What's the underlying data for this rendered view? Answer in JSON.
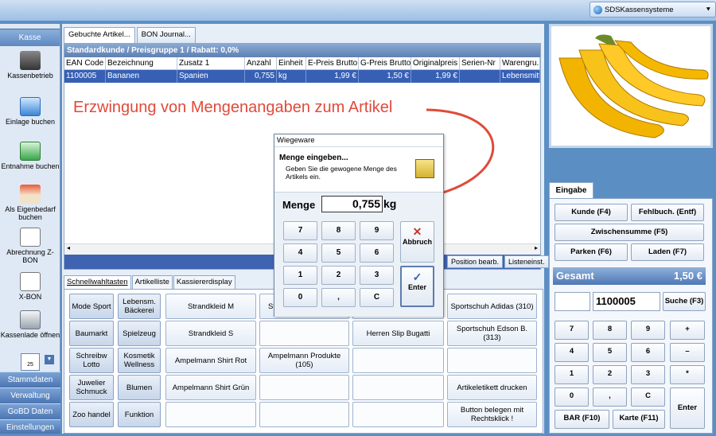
{
  "topbar": {
    "combo_label": "SDSKassensysteme"
  },
  "sidebar": {
    "header": "Kasse",
    "items": [
      "Kassenbetrieb",
      "Einlage buchen",
      "Entnahme buchen",
      "Als Eigenbedarf buchen",
      "Abrechnung Z-BON",
      "X-BON",
      "Kassenlade öffnen"
    ],
    "calendar_day": "25",
    "bottom": [
      "Stammdaten",
      "Verwaltung",
      "GoBD Daten",
      "Einstellungen"
    ]
  },
  "tabs": [
    "Gebuchte Artikel...",
    "BON Journal..."
  ],
  "grid": {
    "title": "Standardkunde / Preisgruppe 1 / Rabatt: 0,0%",
    "columns": [
      "EAN Code",
      "Bezeichnung",
      "Zusatz 1",
      "Anzahl",
      "Einheit",
      "E-Preis Brutto",
      "G-Preis Brutto",
      "Originalpreis",
      "Serien-Nr",
      "Warengru..."
    ],
    "row": [
      "1100005",
      "Bananen",
      "Spanien",
      "0,755",
      "kg",
      "1,99 €",
      "1,50 €",
      "1,99 €",
      "",
      "Lebensmittel"
    ],
    "foot_buttons": [
      "Position bearb.",
      "Listeneinst."
    ]
  },
  "annotation": "Erzwingung von Mengenangaben zum Artikel",
  "bottom_tabs": [
    "Schnellwahltasten",
    "Artikelliste",
    "Kassiererdisplay"
  ],
  "quick": {
    "categories": [
      "Mode Sport",
      "Lebensm. Bäckerei",
      "Baumarkt",
      "Spielzeug",
      "Schreibw Lotto",
      "Kosmetik Wellness",
      "Juwelier Schmuck",
      "Blumen",
      "Zoo handel",
      "Funktion"
    ],
    "col3": [
      "Strandkleid M",
      "Strandkleid S",
      "Ampelmann Shirt Rot",
      "Ampelmann Shirt Grün",
      ""
    ],
    "col4": [
      "St",
      "",
      "Ampelmann Produkte (105)",
      "",
      ""
    ],
    "col5": [
      "",
      "Herren Slip Bugatti",
      "",
      "",
      ""
    ],
    "col6": [
      "Sportschuh Adidas (310)",
      "Sportschuh Edson B. (313)",
      "",
      "Artikeletikett drucken",
      "Button belegen mit Rechtsklick !"
    ]
  },
  "dialog": {
    "title": "Wiegeware",
    "heading": "Menge eingeben...",
    "description": "Geben Sie die gewogene Menge des Artikels ein.",
    "label": "Menge",
    "value": "0,755",
    "unit": "kg",
    "keys": [
      "7",
      "8",
      "9",
      "4",
      "5",
      "6",
      "1",
      "2",
      "3",
      "0",
      ",",
      "C"
    ],
    "abbruch": "Abbruch",
    "enter": "Enter"
  },
  "eingabe": {
    "tab": "Eingabe",
    "buttons": {
      "kunde": "Kunde (F4)",
      "fehlbuch": "Fehlbuch. (Entf)",
      "zwischensumme": "Zwischensumme (F5)",
      "parken": "Parken (F6)",
      "laden": "Laden (F7)",
      "suche": "Suche (F3)",
      "bar": "BAR (F10)",
      "karte": "Karte (F11)",
      "enter": "Enter"
    },
    "gesamt_label": "Gesamt",
    "gesamt_value": "1,50 €",
    "input_value": "1100005",
    "keys": [
      "7",
      "8",
      "9",
      "+",
      "4",
      "5",
      "6",
      "–",
      "1",
      "2",
      "3",
      "*",
      "0",
      ",",
      "C"
    ]
  },
  "colors": {
    "accent": "#3760b5",
    "annotation": "#e04a3a"
  }
}
